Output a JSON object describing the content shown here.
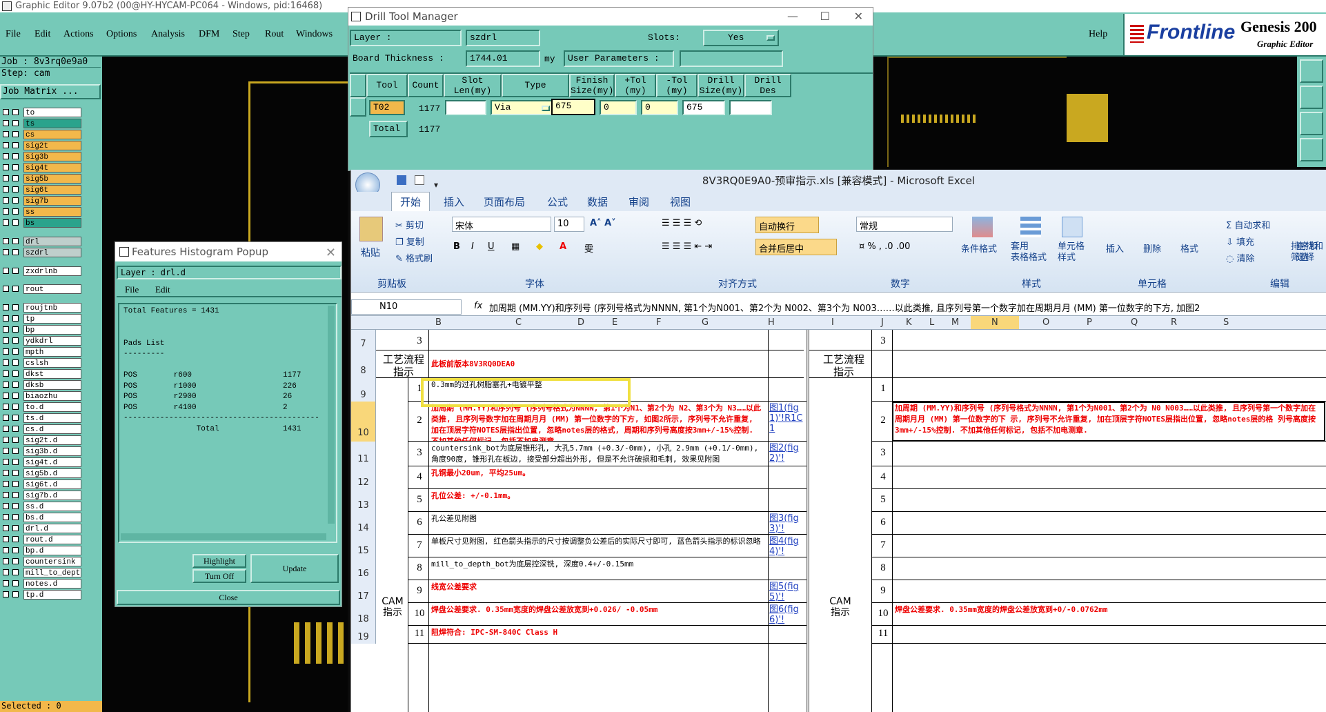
{
  "ge": {
    "title": "Graphic Editor 9.07b2 (00@HY-HYCAM-PC064 - Windows, pid:16468)",
    "menus": [
      "File",
      "Edit",
      "Actions",
      "Options",
      "Analysis",
      "DFM",
      "Step",
      "Rout",
      "Windows"
    ],
    "help": "Help",
    "brand": "Frontline",
    "product": "Genesis 200",
    "product_sub": "Graphic Editor",
    "job": "Job : 8v3rq0e9a0",
    "step": "Step: cam",
    "job_matrix": "Job Matrix ...",
    "selected": "Selected : 0",
    "layers": [
      {
        "name": "to",
        "color": "#ffffff"
      },
      {
        "name": "ts",
        "color": "#2aa38c"
      },
      {
        "name": "cs",
        "color": "#f2b84b"
      },
      {
        "name": "sig2t",
        "color": "#f2b84b"
      },
      {
        "name": "sig3b",
        "color": "#f2b84b"
      },
      {
        "name": "sig4t",
        "color": "#f2b84b"
      },
      {
        "name": "sig5b",
        "color": "#f2b84b"
      },
      {
        "name": "sig6t",
        "color": "#f2b84b"
      },
      {
        "name": "sig7b",
        "color": "#f2b84b"
      },
      {
        "name": "ss",
        "color": "#f2b84b"
      },
      {
        "name": "bs",
        "color": "#2aa38c"
      },
      {
        "name": "drl",
        "color": "#bfcfcc"
      },
      {
        "name": "szdrl",
        "color": "#bfcfcc"
      },
      {
        "name": "zxdrlnb",
        "color": "#ffffff"
      },
      {
        "name": "rout",
        "color": "#ffffff"
      },
      {
        "name": "roujtnb",
        "color": "#ffffff"
      },
      {
        "name": "tp",
        "color": "#ffffff"
      },
      {
        "name": "bp",
        "color": "#ffffff"
      },
      {
        "name": "ydkdrl",
        "color": "#ffffff"
      },
      {
        "name": "mpth",
        "color": "#ffffff"
      },
      {
        "name": "cslsh",
        "color": "#ffffff"
      },
      {
        "name": "dkst",
        "color": "#ffffff"
      },
      {
        "name": "dksb",
        "color": "#ffffff"
      },
      {
        "name": "biaozhu",
        "color": "#ffffff"
      },
      {
        "name": "to.d",
        "color": "#ffffff"
      },
      {
        "name": "ts.d",
        "color": "#ffffff"
      },
      {
        "name": "cs.d",
        "color": "#ffffff"
      },
      {
        "name": "sig2t.d",
        "color": "#ffffff"
      },
      {
        "name": "sig3b.d",
        "color": "#ffffff"
      },
      {
        "name": "sig4t.d",
        "color": "#ffffff"
      },
      {
        "name": "sig5b.d",
        "color": "#ffffff"
      },
      {
        "name": "sig6t.d",
        "color": "#ffffff"
      },
      {
        "name": "sig7b.d",
        "color": "#ffffff"
      },
      {
        "name": "ss.d",
        "color": "#ffffff"
      },
      {
        "name": "bs.d",
        "color": "#ffffff"
      },
      {
        "name": "drl.d",
        "color": "#ffffff"
      },
      {
        "name": "rout.d",
        "color": "#ffffff"
      },
      {
        "name": "bp.d",
        "color": "#ffffff"
      },
      {
        "name": "countersink",
        "color": "#ffffff"
      },
      {
        "name": "mill_to_dept",
        "color": "#ffffff"
      },
      {
        "name": "notes.d",
        "color": "#ffffff"
      },
      {
        "name": "tp.d",
        "color": "#ffffff"
      }
    ]
  },
  "dtm": {
    "title": "Drill Tool Manager",
    "layer_label": "Layer :",
    "layer_value": "szdrl",
    "slots_label": "Slots:",
    "slots_value": "Yes",
    "thick_label": "Board Thickness :",
    "thick_value": "1744.01",
    "thick_unit": "my",
    "user_params": "User Parameters :",
    "headers": [
      "Tool",
      "Count",
      "Slot Len(my)",
      "Type",
      "Finish Size(my)",
      "+Tol (my)",
      "-Tol (my)",
      "Drill Size(my)",
      "Drill Des"
    ],
    "row": {
      "tool": "T02",
      "count": "1177",
      "slot": "",
      "type": "Via",
      "finish": "675",
      "ptol": "0",
      "mtol": "0",
      "drill": "675",
      "des": ""
    },
    "total_label": "Total",
    "total_count": "1177"
  },
  "fh": {
    "title": "Features Histogram Popup",
    "layer": "Layer :  drl.d",
    "menus": [
      "File",
      "Edit"
    ],
    "lines": [
      "Total Features = 1431",
      "",
      "",
      "Pads List",
      "---------",
      "",
      "POS        r600                    1177",
      "POS        r1000                   226",
      "POS        r2900                   26",
      "POS        r4100                   2",
      "-------------------------------------------",
      "                Total              1431"
    ],
    "highlight": "Highlight",
    "turn_off": "Turn Off",
    "update": "Update",
    "close": "Close"
  },
  "xl": {
    "title": "8V3RQ0E9A0-预审指示.xls  [兼容模式] - Microsoft Excel",
    "tabs": [
      "开始",
      "插入",
      "页面布局",
      "公式",
      "数据",
      "审阅",
      "视图"
    ],
    "clipboard": {
      "paste": "粘贴",
      "cut": "剪切",
      "copy": "复制",
      "fmt": "格式刷",
      "group": "剪贴板"
    },
    "font": {
      "name": "宋体",
      "size": "10",
      "group": "字体"
    },
    "align": {
      "wrap": "自动换行",
      "merge": "合并后居中",
      "group": "对齐方式"
    },
    "number": {
      "fmt": "常规",
      "group": "数字"
    },
    "styles": {
      "cond": "条件格式",
      "table": "套用\n表格格式",
      "cell": "单元格\n样式",
      "group": "样式"
    },
    "cells": {
      "insert": "插入",
      "delete": "删除",
      "format": "格式",
      "group": "单元格"
    },
    "edit": {
      "sum": "自动求和",
      "fill": "填充",
      "clear": "清除",
      "sort": "排序和\n筛选",
      "find": "查找和\n选择",
      "group": "编辑"
    },
    "namebox": "N10",
    "fx": "fx",
    "formula": "加周期 (MM.YY)和序列号 (序列号格式为NNNN, 第1个为N001、第2个为 N002、第3个为 N003……以此类推, 且序列号第一个数字加在周期月月 (MM) 第一位数字的下方, 加图2",
    "cols": [
      "B",
      "C",
      "D",
      "E",
      "F",
      "G",
      "H",
      "I",
      "J",
      "K",
      "L",
      "M",
      "N",
      "O",
      "P",
      "Q",
      "R",
      "S"
    ],
    "rows": [
      "7",
      "8",
      "9",
      "10",
      "11",
      "12",
      "13",
      "14",
      "15",
      "16",
      "17",
      "18",
      "19"
    ],
    "top_b": "3",
    "top_m": "3",
    "proc_label": "工艺流程\n指示",
    "proc_text": "此板前版本8V3RQ0DEA0",
    "cam_label": "CAM\n指示",
    "items": [
      {
        "n": "1",
        "text": "0.3mm的过孔树脂塞孔+电镀平整",
        "red": false,
        "link": "",
        "right": ""
      },
      {
        "n": "2",
        "text": "加周期 (MM.YY)和序列号 (序列号格式为NNNN, 第1个为N1、第2个为 N2、第3个为 N3……以此类推, 且序列号数字加在周期月月 (MM) 第一位数字的下方, 如图2所示, 序列号不允许重复, 加在顶层字符NOTES层指出位置, 忽略notes层的格式, 周期和序列号高度按3mm+/-15%控制. 不加其他任何标记, 包括不加电测章.",
        "red": true,
        "link": "图1(fig1)'!R1C1",
        "right": "加周期 (MM.YY)和序列号 (序列号格式为NNNN, 第1个为N001、第2个为 N0 N003……以此类推, 且序列号第一个数字加在周期月月 (MM) 第一位数字的下 示, 序列号不允许重复, 加在顶层字符NOTES层指出位置, 忽略notes层的格 列号高度按3mm+/-15%控制. 不加其他任何标记, 包括不加电测章."
      },
      {
        "n": "3",
        "text": "countersink_bot为底层锥形孔, 大孔5.7mm (+0.3/-0mm), 小孔 2.9mm (+0.1/-0mm), 角度90度, 锥形孔在板边, 接受部分超出外形, 但是不允许破损和毛刺, 效果见附图",
        "red": false,
        "link": "图2(fig2)'!",
        "right": ""
      },
      {
        "n": "4",
        "text": "孔铜最小20um, 平均25um。",
        "red": true,
        "link": "",
        "right": ""
      },
      {
        "n": "5",
        "text": "孔位公差: +/-0.1mm。",
        "red": true,
        "link": "",
        "right": ""
      },
      {
        "n": "6",
        "text": "孔公差见附图",
        "red": false,
        "link": "图3(fig3)'!",
        "right": ""
      },
      {
        "n": "7",
        "text": "单板尺寸见附图, 红色箭头指示的尺寸按调整负公差后的实际尺寸即可, 蓝色箭头指示的标识忽略",
        "red": false,
        "link": "图4(fig4)'!",
        "right": ""
      },
      {
        "n": "8",
        "text": "mill_to_depth_bot为底层控深铣, 深度0.4+/-0.15mm",
        "red": false,
        "link": "",
        "right": ""
      },
      {
        "n": "9",
        "text": "线宽公差要求",
        "red": true,
        "link": "图5(fig5)'!",
        "right": ""
      },
      {
        "n": "10",
        "text": "焊盘公差要求. 0.35mm宽度的焊盘公差放宽到+0.026/ -0.05mm",
        "red": true,
        "link": "图6(fig6)'!",
        "right": "焊盘公差要求. 0.35mm宽度的焊盘公差放宽到+0/-0.0762mm"
      },
      {
        "n": "11",
        "text": "阻焊符合: IPC-SM-840C Class H",
        "red": true,
        "link": "",
        "right": ""
      }
    ]
  }
}
